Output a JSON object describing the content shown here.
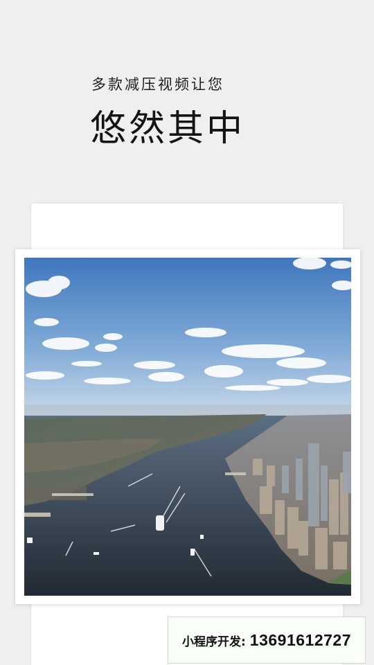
{
  "header": {
    "subtitle": "多款减压视频让您",
    "title": "悠然其中"
  },
  "media": {
    "image_subject": "aerial-city-river-photo"
  },
  "contact": {
    "label": "小程序开发:",
    "phone": "13691612727"
  }
}
